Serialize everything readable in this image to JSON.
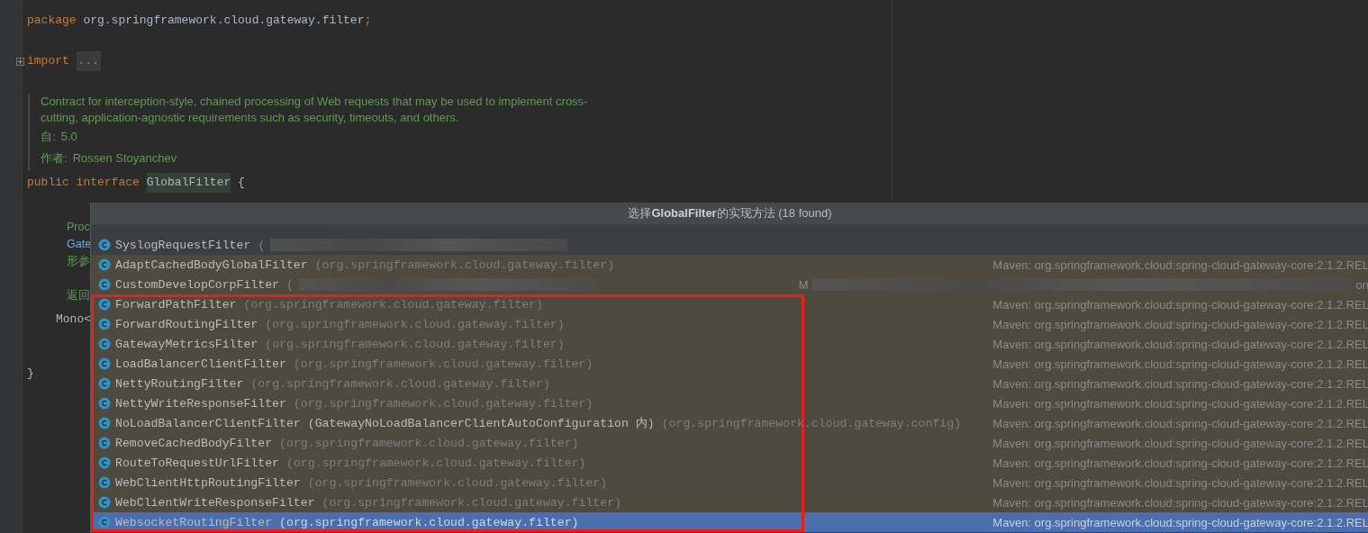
{
  "editor": {
    "lines": [
      {
        "kind": "package",
        "keyword": "package",
        "text": "org.springframework.cloud.gateway.filter",
        "end": ";"
      },
      {
        "kind": "import",
        "keyword": "import",
        "text": "..."
      },
      {
        "kind": "doc",
        "text": "Contract for interception-style, chained processing of Web requests that may be used to implement cross-cutting, application-agnostic requirements such as security, timeouts, and others.",
        "tags": [
          {
            "label": "自:",
            "value": "5.0"
          },
          {
            "label": "作者:",
            "value": "Rossen Stoyanchev"
          }
        ]
      },
      {
        "kind": "decl",
        "keywords": [
          "public",
          "interface"
        ],
        "name": "GlobalFilter",
        "end": "{"
      }
    ],
    "hidden_lines": [
      {
        "kind": "doc",
        "text": "Proc"
      },
      {
        "kind": "link",
        "text": "Gate"
      },
      {
        "kind": "doc",
        "text": "形参"
      },
      {
        "kind": "gap"
      },
      {
        "kind": "doc",
        "text": "返回"
      },
      {
        "kind": "code",
        "text": "Mono<"
      },
      {
        "kind": "gap"
      },
      {
        "kind": "code",
        "text": "}"
      }
    ]
  },
  "popup": {
    "title_prefix": "选择",
    "title_bold": "GlobalFilter",
    "title_suffix": "的实现方法 (18 found)",
    "rows": [
      {
        "kind": "project",
        "name": "SyslogRequestFilter",
        "package": "(",
        "redacted": true,
        "selected": false,
        "boxed": false
      },
      {
        "kind": "library",
        "name": "AdaptCachedBodyGlobalFilter",
        "package": "(org.springframework.cloud.gateway.filter)",
        "location": "Maven: org.springframework.cloud:spring-cloud-gateway-core:2.1.2.REL",
        "redacted": false,
        "selected": false,
        "boxed": false
      },
      {
        "kind": "library",
        "name": "CustomDevelopCorpFilter",
        "package": "(",
        "location": "M",
        "location_end": "on",
        "redacted": true,
        "selected": false,
        "boxed": false
      },
      {
        "kind": "library",
        "name": "ForwardPathFilter",
        "package": "(org.springframework.cloud.gateway.filter)",
        "location": "Maven: org.springframework.cloud:spring-cloud-gateway-core:2.1.2.REL",
        "redacted": false,
        "selected": false,
        "boxed": true
      },
      {
        "kind": "library",
        "name": "ForwardRoutingFilter",
        "package": "(org.springframework.cloud.gateway.filter)",
        "location": "Maven: org.springframework.cloud:spring-cloud-gateway-core:2.1.2.REL",
        "redacted": false,
        "selected": false,
        "boxed": true
      },
      {
        "kind": "library",
        "name": "GatewayMetricsFilter",
        "package": "(org.springframework.cloud.gateway.filter)",
        "location": "Maven: org.springframework.cloud:spring-cloud-gateway-core:2.1.2.REL",
        "redacted": false,
        "selected": false,
        "boxed": true
      },
      {
        "kind": "library",
        "name": "LoadBalancerClientFilter",
        "package": "(org.springframework.cloud.gateway.filter)",
        "location": "Maven: org.springframework.cloud:spring-cloud-gateway-core:2.1.2.REL",
        "redacted": false,
        "selected": false,
        "boxed": true
      },
      {
        "kind": "library",
        "name": "NettyRoutingFilter",
        "package": "(org.springframework.cloud.gateway.filter)",
        "location": "Maven: org.springframework.cloud:spring-cloud-gateway-core:2.1.2.REL",
        "redacted": false,
        "selected": false,
        "boxed": true
      },
      {
        "kind": "library",
        "name": "NettyWriteResponseFilter",
        "package": "(org.springframework.cloud.gateway.filter)",
        "location": "Maven: org.springframework.cloud:spring-cloud-gateway-core:2.1.2.REL",
        "redacted": false,
        "selected": false,
        "boxed": true
      },
      {
        "kind": "library",
        "name": "NoLoadBalancerClientFilter",
        "outer": "(GatewayNoLoadBalancerClientAutoConfiguration 内)",
        "package": "(org.springframework.cloud.gateway.config)",
        "location": "Maven: org.springframework.cloud:spring-cloud-gateway-core:2.1.2.REL",
        "redacted": false,
        "selected": false,
        "boxed": true
      },
      {
        "kind": "library",
        "name": "RemoveCachedBodyFilter",
        "package": "(org.springframework.cloud.gateway.filter)",
        "location": "Maven: org.springframework.cloud:spring-cloud-gateway-core:2.1.2.REL",
        "redacted": false,
        "selected": false,
        "boxed": true
      },
      {
        "kind": "library",
        "name": "RouteToRequestUrlFilter",
        "package": "(org.springframework.cloud.gateway.filter)",
        "location": "Maven: org.springframework.cloud:spring-cloud-gateway-core:2.1.2.REL",
        "redacted": false,
        "selected": false,
        "boxed": true
      },
      {
        "kind": "library",
        "name": "WebClientHttpRoutingFilter",
        "package": "(org.springframework.cloud.gateway.filter)",
        "location": "Maven: org.springframework.cloud:spring-cloud-gateway-core:2.1.2.REL",
        "redacted": false,
        "selected": false,
        "boxed": true
      },
      {
        "kind": "library",
        "name": "WebClientWriteResponseFilter",
        "package": "(org.springframework.cloud.gateway.filter)",
        "location": "Maven: org.springframework.cloud:spring-cloud-gateway-core:2.1.2.REL",
        "redacted": false,
        "selected": false,
        "boxed": true
      },
      {
        "kind": "library",
        "name": "WebsocketRoutingFilter",
        "package": "(org.springframework.cloud.gateway.filter)",
        "location": "Maven: org.springframework.cloud:spring-cloud-gateway-core:2.1.2.REL",
        "redacted": false,
        "selected": true,
        "boxed": true
      }
    ]
  }
}
